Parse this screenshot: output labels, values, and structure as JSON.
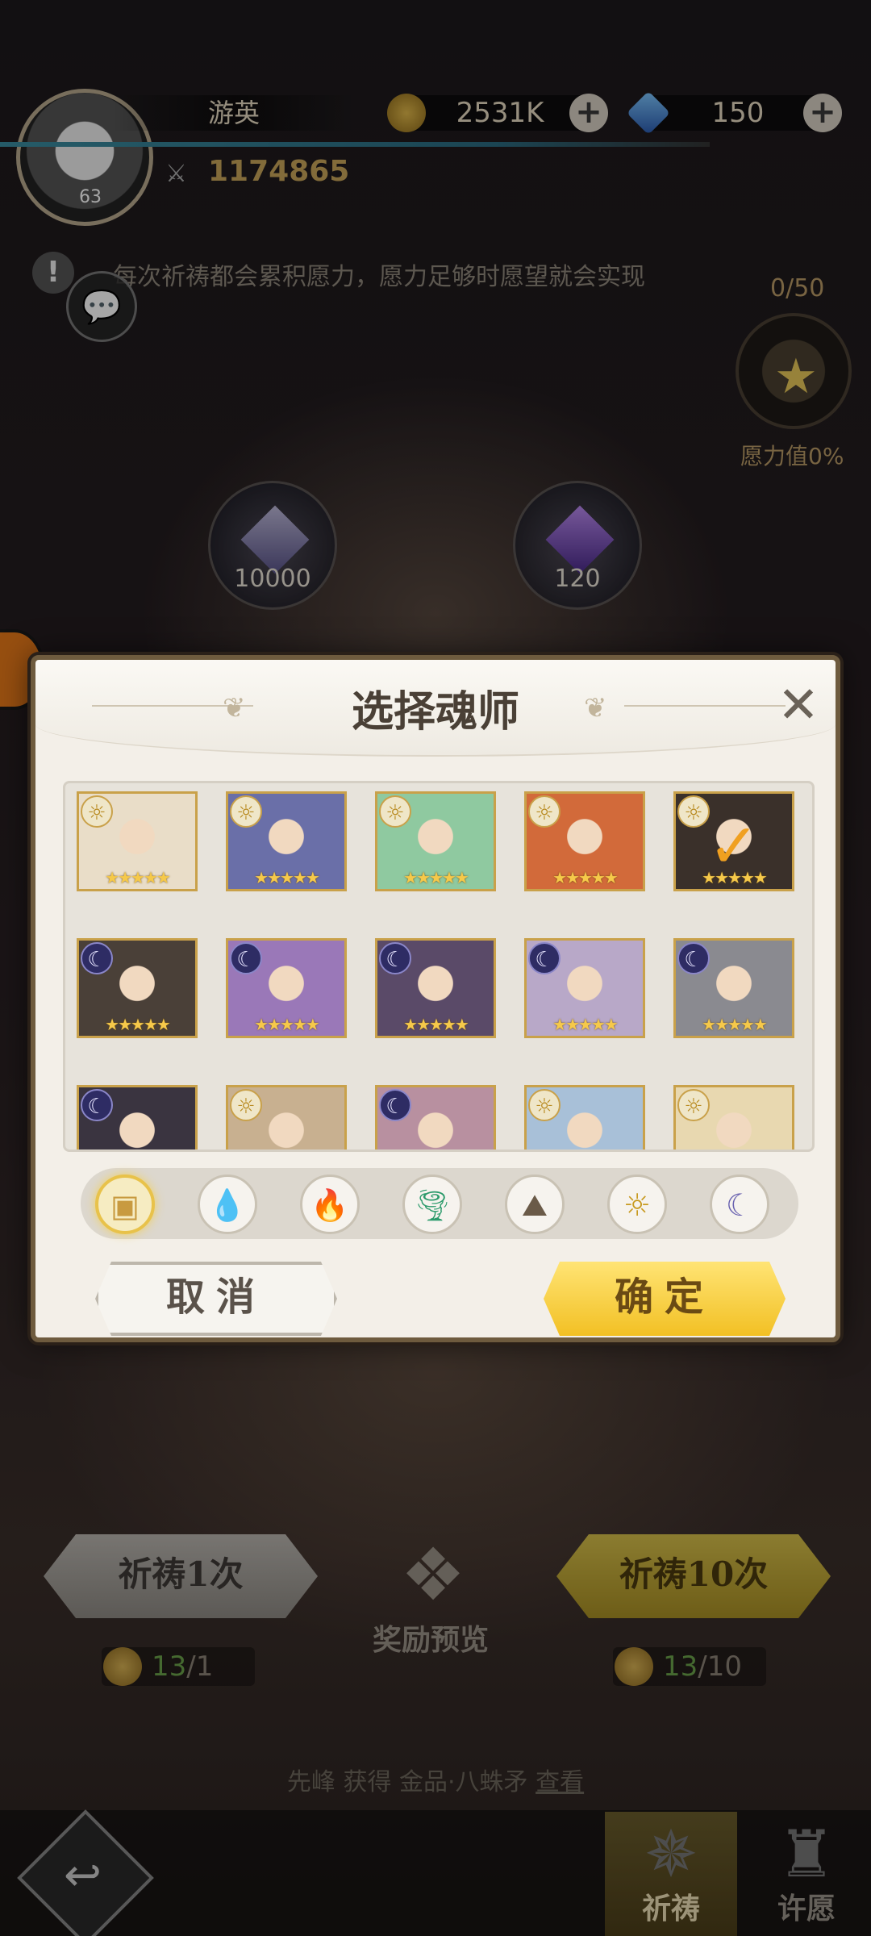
{
  "player": {
    "name": "游英",
    "level": "63",
    "power": "1174865",
    "gold": "2531K",
    "diamonds": "150"
  },
  "tip": "每次祈祷都会累积愿力，愿力足够时愿望就会实现",
  "wish": {
    "count": "0/50",
    "label": "愿力值0%"
  },
  "orbs": [
    {
      "value": "10000"
    },
    {
      "value": "120"
    }
  ],
  "modal": {
    "title": "选择魂师",
    "cancel_label": "取消",
    "confirm_label": "确定",
    "heroes": [
      {
        "elem": "light",
        "stars": "★★★★★",
        "selected": false
      },
      {
        "elem": "light",
        "stars": "★★★★★",
        "selected": false
      },
      {
        "elem": "light",
        "stars": "★★★★★",
        "selected": false
      },
      {
        "elem": "light",
        "stars": "★★★★★",
        "selected": false
      },
      {
        "elem": "light",
        "stars": "★★★★★",
        "selected": true
      },
      {
        "elem": "dark",
        "stars": "★★★★★",
        "selected": false
      },
      {
        "elem": "dark",
        "stars": "★★★★★",
        "selected": false
      },
      {
        "elem": "dark",
        "stars": "★★★★★",
        "selected": false
      },
      {
        "elem": "dark",
        "stars": "★★★★★",
        "selected": false
      },
      {
        "elem": "dark",
        "stars": "★★★★★",
        "selected": false
      },
      {
        "elem": "dark",
        "stars": "",
        "selected": false
      },
      {
        "elem": "light",
        "stars": "",
        "selected": false
      },
      {
        "elem": "dark",
        "stars": "",
        "selected": false
      },
      {
        "elem": "light",
        "stars": "",
        "selected": false
      },
      {
        "elem": "light",
        "stars": "",
        "selected": false
      }
    ],
    "filters": [
      {
        "icon": "all-box-icon",
        "active": true
      },
      {
        "icon": "water-icon",
        "active": false
      },
      {
        "icon": "fire-icon",
        "active": false
      },
      {
        "icon": "wind-icon",
        "active": false
      },
      {
        "icon": "earth-icon",
        "active": false
      },
      {
        "icon": "light-icon",
        "active": false
      },
      {
        "icon": "dark-icon",
        "active": false
      }
    ]
  },
  "actions": {
    "pray_once": "祈祷1次",
    "pray_ten": "祈祷10次",
    "reward_preview": "奖励预览",
    "cost_once_have": "13",
    "cost_once_need": "/1",
    "cost_ten_have": "13",
    "cost_ten_need": "/10"
  },
  "news": {
    "text": "先峰 获得 金品·八蛛矛 ",
    "link": "查看"
  },
  "nav": {
    "pray_tab": "祈祷",
    "wish_tab": "许愿"
  },
  "colors": {
    "accent_gold": "#f2c024",
    "panel": "#f3efe8",
    "frame": "#6e5b3e"
  }
}
